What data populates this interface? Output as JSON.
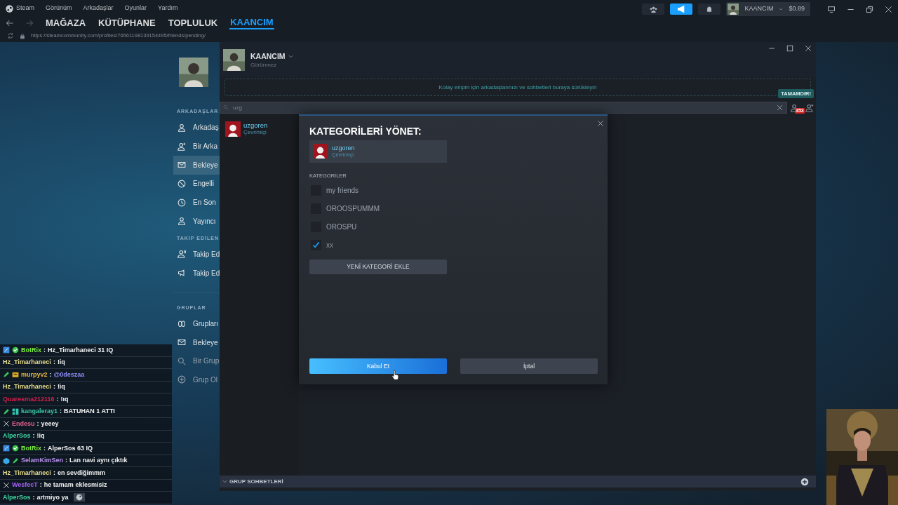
{
  "menu_bar": {
    "items": [
      "Steam",
      "Görünüm",
      "Arkadaşlar",
      "Oyunlar",
      "Yardım"
    ]
  },
  "top_right": {
    "announcements_active": true,
    "account_name": "KAANCIM",
    "balance": "$0.89"
  },
  "nav_tabs": [
    {
      "label": "MAĞAZA",
      "selected": false
    },
    {
      "label": "KÜTÜPHANE",
      "selected": false
    },
    {
      "label": "TOPLULUK",
      "selected": false
    },
    {
      "label": "KAANCIM",
      "selected": true
    }
  ],
  "url": "https://steamcommunity.com/profiles/76561198139154495/friends/pending/",
  "profile_sidebar": {
    "sections": [
      {
        "heading": "ARKADAŞLAR",
        "items": [
          {
            "label": "Arkadaş",
            "selected": false
          },
          {
            "label": "Bir Arka",
            "selected": false
          },
          {
            "label": "Bekleye",
            "selected": true
          },
          {
            "label": "Engelli",
            "selected": false
          },
          {
            "label": "En Son",
            "selected": false
          },
          {
            "label": "Yayıncı",
            "selected": false
          }
        ]
      },
      {
        "heading": "TAKİP EDİLEN",
        "items": [
          {
            "label": "Takip Ed",
            "selected": false
          },
          {
            "label": "Takip Ed",
            "selected": false
          }
        ]
      },
      {
        "heading": "GRUPLAR",
        "items": [
          {
            "label": "Grupları",
            "selected": false
          },
          {
            "label": "Bekleye",
            "selected": false
          },
          {
            "label": "Bir Grup",
            "selected": false
          },
          {
            "label": "Grup Ol",
            "selected": false
          }
        ]
      }
    ]
  },
  "friends_window": {
    "user": {
      "name": "KAANCIM",
      "status": "Görünmez"
    },
    "drop_hint": "Kolay erişim için arkadaşlarınızı ve sohbetleri buraya sürükleyin",
    "done_badge": "TAMAMDIR!",
    "search": {
      "value": "uzg"
    },
    "pending_count": "353",
    "friends": [
      {
        "name": "uzgoren",
        "status": "Çevrimiçi"
      }
    ],
    "group_chats": "GRUP SOHBETLERİ"
  },
  "modal": {
    "title": "KATEGORİLERİ YÖNET:",
    "friend": {
      "name": "uzgoren",
      "status": "Çevrimiçi"
    },
    "section": "KATEGORİLER",
    "categories": [
      {
        "label": "my friends",
        "checked": false
      },
      {
        "label": "OROOSPUMMM",
        "checked": false
      },
      {
        "label": "OROSPU",
        "checked": false
      },
      {
        "label": "xx",
        "checked": true
      }
    ],
    "add_button": "YENİ KATEGORİ EKLE",
    "buttons": [
      {
        "label": "Kabul Et",
        "kind": "primary"
      },
      {
        "label": "İptal",
        "kind": "secondary"
      }
    ]
  },
  "chat": [
    {
      "user": "BotRix",
      "color": "#7cf03c",
      "separator": ":",
      "text": "Hz_Timarhaneci 31 IQ",
      "mention": false
    },
    {
      "user": "Hz_Timarhaneci",
      "color": "#e8dc8c",
      "separator": ":",
      "text": "!iq",
      "mention": false
    },
    {
      "user": "murpyv2",
      "color": "#e2b444",
      "separator": ":",
      "text": "@0deszaa",
      "mention": true
    },
    {
      "user": "Hz_Timarhaneci",
      "color": "#e8dc8c",
      "separator": ":",
      "text": "!iq",
      "mention": false
    },
    {
      "user": "Quaresma212116",
      "color": "#d4204c",
      "separator": ":",
      "text": "!ıq",
      "mention": false
    },
    {
      "user": "kangaleray1",
      "color": "#3cc8a8",
      "separator": ":",
      "text": "BATUHAN 1 ATTI",
      "mention": false
    },
    {
      "user": "Endesu",
      "color": "#e0608c",
      "separator": ":",
      "text": "yeeey",
      "mention": false
    },
    {
      "user": "AlperSos",
      "color": "#40d4a0",
      "separator": ":",
      "text": "!iq",
      "mention": false
    },
    {
      "user": "BotRix",
      "color": "#7cf03c",
      "separator": ":",
      "text": "AlperSos 63 IQ",
      "mention": false
    },
    {
      "user": "SelamKimSen",
      "color": "#b890f0",
      "separator": ":",
      "text": "Lan navi aynı çıktık",
      "mention": false
    },
    {
      "user": "Hz_Timarhaneci",
      "color": "#e8dc8c",
      "separator": ":",
      "text": "en sevdiğimmm",
      "mention": false
    },
    {
      "user": "WesfecT",
      "color": "#a464f4",
      "separator": ":",
      "text": "he tamam eklesmisiz",
      "mention": false
    },
    {
      "user": "AlperSos",
      "color": "#40d4a0",
      "separator": ":",
      "text": "artmiyo ya",
      "mention": false
    }
  ]
}
